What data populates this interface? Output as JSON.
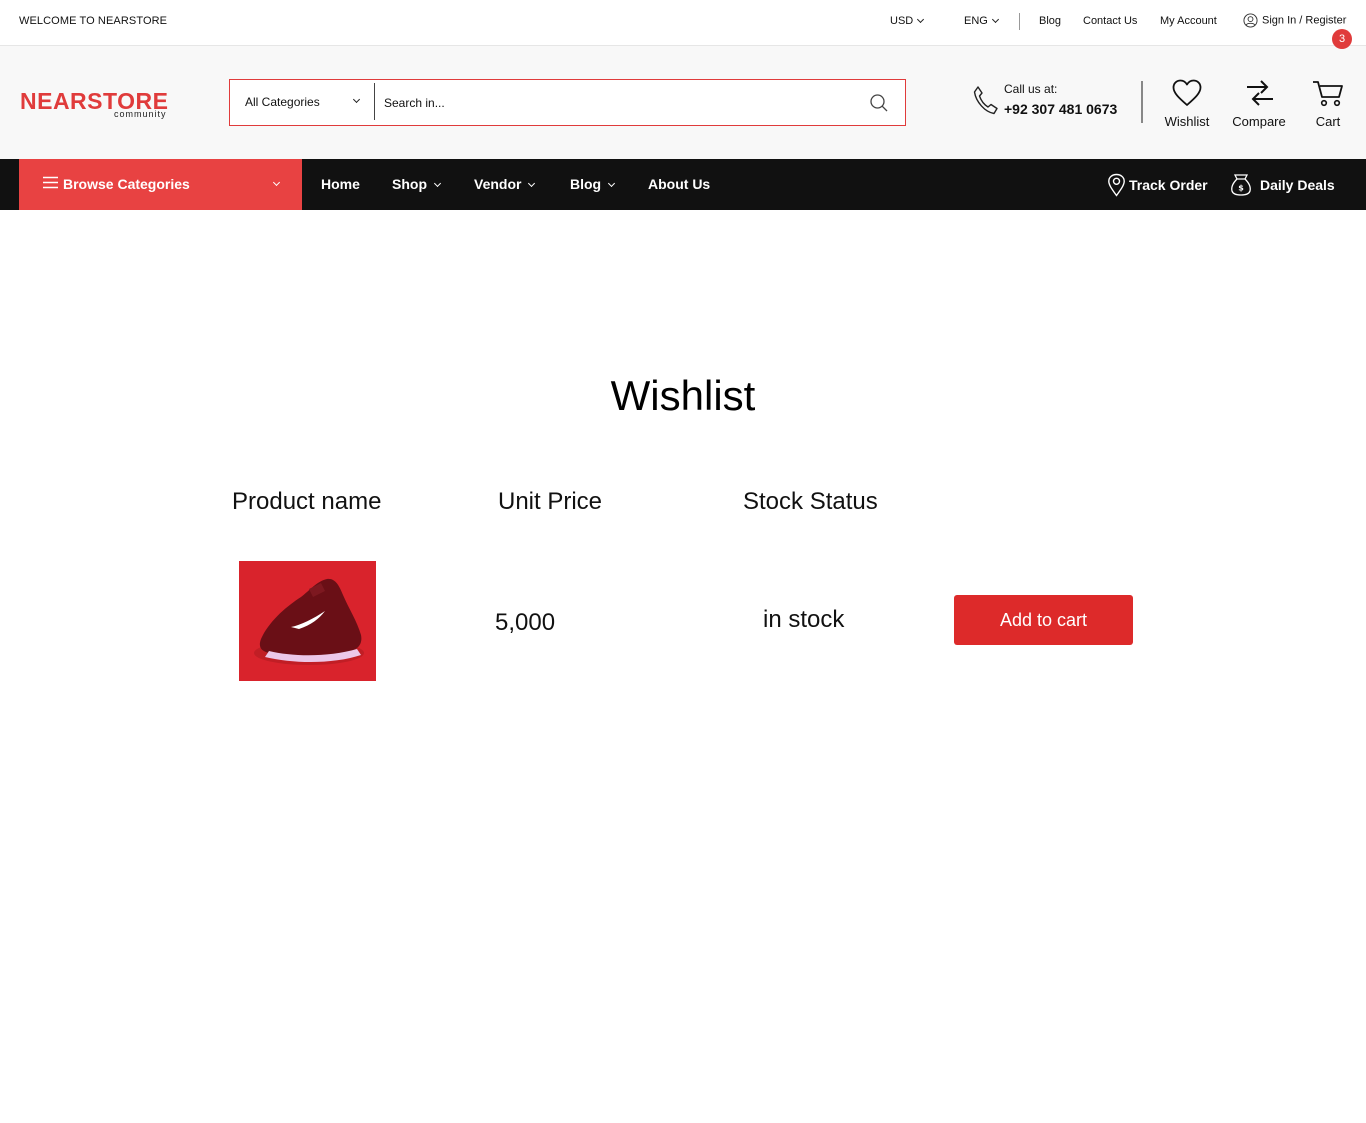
{
  "topbar": {
    "welcome": "WELCOME TO NEARSTORE",
    "currency": "USD",
    "language": "ENG",
    "links": [
      "Blog",
      "Contact Us",
      "My Account"
    ],
    "signin": "Sign In / Register"
  },
  "header": {
    "logo_main": "NEARSTORE",
    "logo_sub": "community",
    "search": {
      "category": "All Categories",
      "placeholder": "Search in..."
    },
    "call_label": "Call us at:",
    "call_number": "+92 307 481 0673",
    "wishlist_label": "Wishlist",
    "compare_label": "Compare",
    "cart_label": "Cart",
    "cart_count": "3"
  },
  "nav": {
    "browse": "Browse Categories",
    "links": [
      "Home",
      "Shop",
      "Vendor",
      "Blog",
      "About Us"
    ],
    "track_order": "Track Order",
    "daily_deals": "Daily Deals"
  },
  "main": {
    "title": "Wishlist",
    "columns": [
      "Product name",
      "Unit Price",
      "Stock Status"
    ],
    "items": [
      {
        "price": "5,000",
        "stock": "in stock",
        "action": "Add to cart"
      }
    ]
  },
  "colors": {
    "accent": "#e03b3b",
    "nav_bg": "#111111",
    "header_bg": "#f8f8f8"
  }
}
